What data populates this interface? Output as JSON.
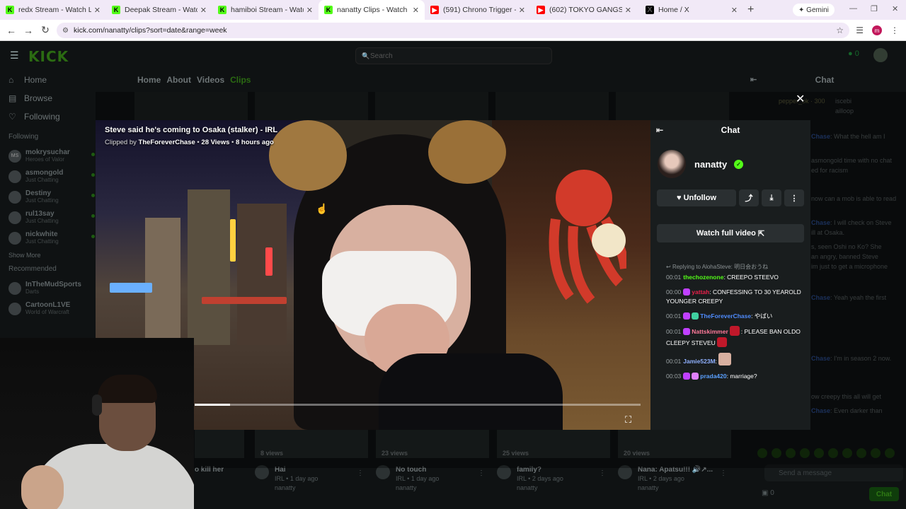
{
  "browser": {
    "tabs": [
      {
        "title": "redx Stream - Watch Live on",
        "icon": "kick"
      },
      {
        "title": "Deepak Stream - Watch Live",
        "icon": "kick"
      },
      {
        "title": "hamiboi Stream - Watch Live",
        "icon": "kick"
      },
      {
        "title": "nanatty Clips - Watch Live on",
        "icon": "kick",
        "active": true
      },
      {
        "title": "(591) Chrono Trigger - Wind",
        "icon": "youtube"
      },
      {
        "title": "(602) TOKYO GANGSTERS CA",
        "icon": "youtube"
      },
      {
        "title": "Home / X",
        "icon": "x"
      }
    ],
    "gemini_label": "Gemini",
    "url": "kick.com/nanatty/clips?sort=date&range=week",
    "profile_initial": "m"
  },
  "kick": {
    "logo": "KICK",
    "search_placeholder": "Search",
    "points": "0",
    "sidebar": {
      "main": [
        {
          "label": "Home",
          "icon": "home-icon"
        },
        {
          "label": "Browse",
          "icon": "browse-icon"
        },
        {
          "label": "Following",
          "icon": "heart-icon"
        }
      ],
      "following_heading": "Following",
      "following": [
        {
          "name": "mokrysuchar",
          "sub": "Heroes of Valor",
          "initials": "MS"
        },
        {
          "name": "asmongold",
          "sub": "Just Chatting"
        },
        {
          "name": "Destiny",
          "sub": "Just Chatting"
        },
        {
          "name": "rul13say",
          "sub": "Just Chatting"
        },
        {
          "name": "nickwhite",
          "sub": "Just Chatting"
        }
      ],
      "show_more": "Show More",
      "recommended_heading": "Recommended",
      "recommended": [
        {
          "name": "InTheMudSports",
          "sub": "Darts"
        },
        {
          "name": "CartoonL1VE",
          "sub": "World of Warcraft"
        }
      ]
    },
    "channel_tabs": [
      "Home",
      "About",
      "Videos",
      "Clips"
    ],
    "right_chat": {
      "title": "Chat",
      "top_user": "pepper_ok",
      "top_count": "300",
      "users_right": [
        "iscebi",
        "ailloop"
      ],
      "lines": [
        {
          "user": "Chase",
          "text": ": What the hell am I"
        },
        {
          "user": "",
          "text": "asmongold time with no chat"
        },
        {
          "user": "",
          "text": "ed for racism"
        },
        {
          "user": "",
          "text": "now can a mob is able to read"
        },
        {
          "user": "Chase",
          "text": ": I will check on Steve"
        },
        {
          "user": "",
          "text": "ill at Osaka."
        },
        {
          "user": "",
          "text": "s, seen Oshi no Ko? She"
        },
        {
          "user": "",
          "text": "an angry, banned Steve"
        },
        {
          "user": "",
          "text": "im just to get a microphone"
        },
        {
          "user": "Chase",
          "text": ": Yeah yeah the first"
        },
        {
          "user": "Chase",
          "text": ": I'm in season 2 now."
        },
        {
          "user": "",
          "text": "ow creepy this all will get"
        },
        {
          "user": "Chase",
          "text": ": Even darker than"
        }
      ],
      "input_placeholder": "Send a message",
      "count": "0",
      "chat_button": "Chat"
    },
    "clips": [
      {
        "title": "o kill her",
        "views": "",
        "category": "",
        "author": ""
      },
      {
        "title": "Hai",
        "views": "8 views",
        "category": "IRL • 1 day ago",
        "author": "nanatty"
      },
      {
        "title": "No touch",
        "views": "23 views",
        "category": "IRL • 1 day ago",
        "author": "nanatty"
      },
      {
        "title": "family?",
        "views": "25 views",
        "category": "IRL • 2 days ago",
        "author": "nanatty"
      },
      {
        "title": "Nana: Apatsu!!! 🔊↗...",
        "views": "20 views",
        "category": "IRL • 2 days ago",
        "author": "nanatty"
      }
    ]
  },
  "modal": {
    "clip_title": "Steve said he's coming to Osaka (stalker) - IRL",
    "clipped_by_label": "Clipped by",
    "clipper": "TheForeverChase",
    "views": "28 Views",
    "age": "8 hours ago",
    "progress": 0.08,
    "panel": {
      "title": "Chat",
      "channel": "nanatty",
      "unfollow": "Unfollow",
      "watch_full": "Watch full video",
      "reply": "Replying to AlohaSteve: 明日会おうね",
      "messages": [
        {
          "time": "00:01",
          "user": "thechozenone",
          "user_color": "#53fc18",
          "text": ": CREEPO STEEVO"
        },
        {
          "time": "00:00",
          "user": "yattah",
          "user_color": "#e8204a",
          "text": ": CONFESSING TO 30 YEAROLD YOUNGER CREEPY"
        },
        {
          "time": "00:01",
          "user": "TheForeverChase",
          "user_color": "#4f8cff",
          "text": ": やばい"
        },
        {
          "time": "00:01",
          "user": "Nattskimmer",
          "user_color": "#ff7a9a",
          "text": ": PLEASE BAN OLDO CLEEPY STEVEU"
        },
        {
          "time": "00:01",
          "user": "Jamie523M",
          "user_color": "#8fb0ff",
          "text": ":"
        },
        {
          "time": "00:03",
          "user": "prada420",
          "user_color": "#5aa0ff",
          "text": ": marriage?"
        }
      ]
    }
  }
}
